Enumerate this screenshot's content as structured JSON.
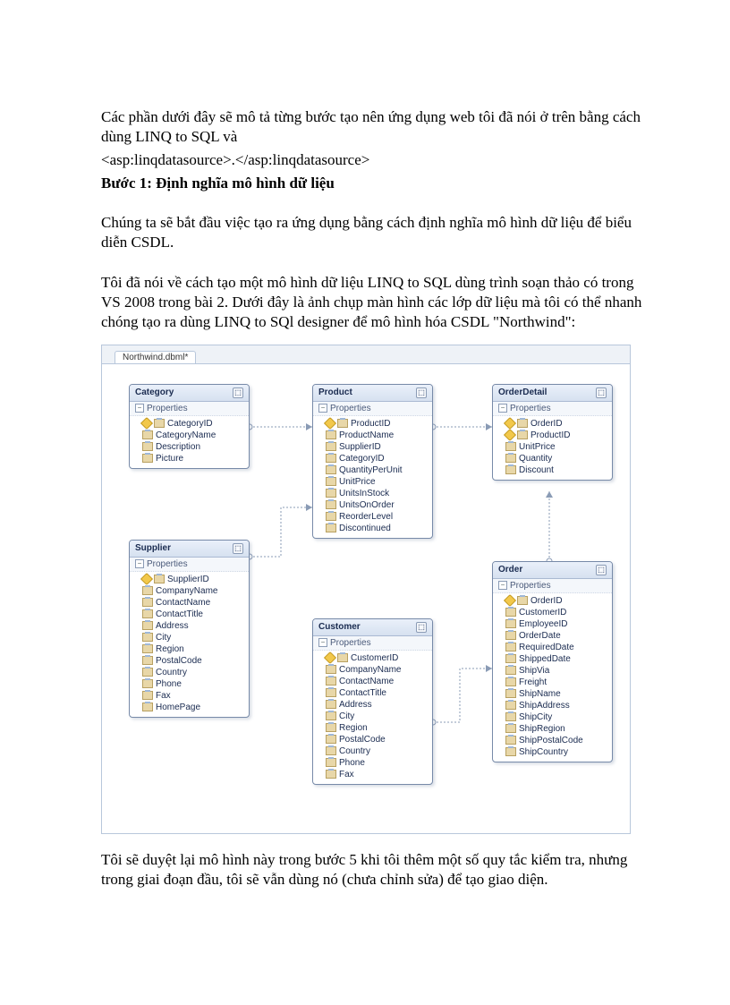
{
  "intro": {
    "p1a": "Các phần dưới đây sẽ mô tả từng bước tạo nên ứng dụng web tôi đã nói ở trên bằng cách dùng LINQ to SQL và",
    "p1b": "<asp:linqdatasource>.</asp:linqdatasource>",
    "step_title": "Bước 1: Định nghĩa mô hình dữ liệu",
    "p2": "Chúng ta sẽ bắt đầu việc tạo ra ứng dụng bằng cách định nghĩa mô hình dữ liệu để biểu diễn CSDL.",
    "p3": "Tôi đã nói về cách tạo một mô hình dữ liệu LINQ to SQL dùng trình soạn thảo có trong VS 2008 trong bài 2. Dưới đây là ảnh chụp màn hình các lớp dữ liệu mà tôi có thể nhanh chóng tạo ra dùng LINQ to SQl designer để mô hình hóa CSDL \"Northwind\":"
  },
  "tab": "Northwind.dbml*",
  "section_label": "Properties",
  "pin_glyph": "⬚",
  "minus_glyph": "−",
  "entities": {
    "category": {
      "title": "Category",
      "props": [
        {
          "key": true,
          "name": "CategoryID"
        },
        {
          "key": false,
          "name": "CategoryName"
        },
        {
          "key": false,
          "name": "Description"
        },
        {
          "key": false,
          "name": "Picture"
        }
      ]
    },
    "supplier": {
      "title": "Supplier",
      "props": [
        {
          "key": true,
          "name": "SupplierID"
        },
        {
          "key": false,
          "name": "CompanyName"
        },
        {
          "key": false,
          "name": "ContactName"
        },
        {
          "key": false,
          "name": "ContactTitle"
        },
        {
          "key": false,
          "name": "Address"
        },
        {
          "key": false,
          "name": "City"
        },
        {
          "key": false,
          "name": "Region"
        },
        {
          "key": false,
          "name": "PostalCode"
        },
        {
          "key": false,
          "name": "Country"
        },
        {
          "key": false,
          "name": "Phone"
        },
        {
          "key": false,
          "name": "Fax"
        },
        {
          "key": false,
          "name": "HomePage"
        }
      ]
    },
    "product": {
      "title": "Product",
      "props": [
        {
          "key": true,
          "name": "ProductID"
        },
        {
          "key": false,
          "name": "ProductName"
        },
        {
          "key": false,
          "name": "SupplierID"
        },
        {
          "key": false,
          "name": "CategoryID"
        },
        {
          "key": false,
          "name": "QuantityPerUnit"
        },
        {
          "key": false,
          "name": "UnitPrice"
        },
        {
          "key": false,
          "name": "UnitsInStock"
        },
        {
          "key": false,
          "name": "UnitsOnOrder"
        },
        {
          "key": false,
          "name": "ReorderLevel"
        },
        {
          "key": false,
          "name": "Discontinued"
        }
      ]
    },
    "customer": {
      "title": "Customer",
      "props": [
        {
          "key": true,
          "name": "CustomerID"
        },
        {
          "key": false,
          "name": "CompanyName"
        },
        {
          "key": false,
          "name": "ContactName"
        },
        {
          "key": false,
          "name": "ContactTitle"
        },
        {
          "key": false,
          "name": "Address"
        },
        {
          "key": false,
          "name": "City"
        },
        {
          "key": false,
          "name": "Region"
        },
        {
          "key": false,
          "name": "PostalCode"
        },
        {
          "key": false,
          "name": "Country"
        },
        {
          "key": false,
          "name": "Phone"
        },
        {
          "key": false,
          "name": "Fax"
        }
      ]
    },
    "orderdetail": {
      "title": "OrderDetail",
      "props": [
        {
          "key": true,
          "name": "OrderID"
        },
        {
          "key": true,
          "name": "ProductID"
        },
        {
          "key": false,
          "name": "UnitPrice"
        },
        {
          "key": false,
          "name": "Quantity"
        },
        {
          "key": false,
          "name": "Discount"
        }
      ]
    },
    "order": {
      "title": "Order",
      "props": [
        {
          "key": true,
          "name": "OrderID"
        },
        {
          "key": false,
          "name": "CustomerID"
        },
        {
          "key": false,
          "name": "EmployeeID"
        },
        {
          "key": false,
          "name": "OrderDate"
        },
        {
          "key": false,
          "name": "RequiredDate"
        },
        {
          "key": false,
          "name": "ShippedDate"
        },
        {
          "key": false,
          "name": "ShipVia"
        },
        {
          "key": false,
          "name": "Freight"
        },
        {
          "key": false,
          "name": "ShipName"
        },
        {
          "key": false,
          "name": "ShipAddress"
        },
        {
          "key": false,
          "name": "ShipCity"
        },
        {
          "key": false,
          "name": "ShipRegion"
        },
        {
          "key": false,
          "name": "ShipPostalCode"
        },
        {
          "key": false,
          "name": "ShipCountry"
        }
      ]
    }
  },
  "outro": "Tôi sẽ duyệt lại mô hình này trong bước 5 khi tôi thêm một số quy tắc kiểm tra, nhưng trong giai đoạn đầu, tôi sẽ vẫn dùng nó (chưa chỉnh sửa) để tạo giao diện."
}
